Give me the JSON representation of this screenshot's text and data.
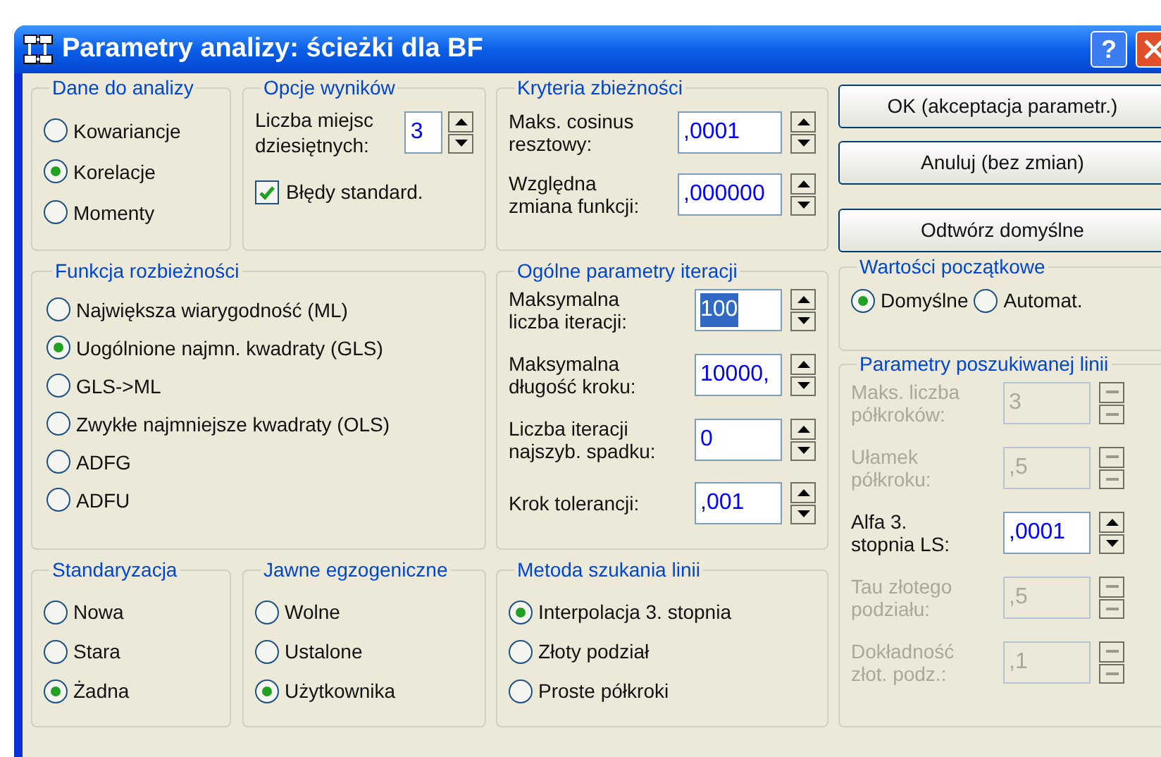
{
  "window": {
    "title": "Parametry analizy: ścieżki dla BF",
    "help_button": "?"
  },
  "data_source": {
    "title": "Dane do analizy",
    "options": [
      {
        "label": "Kowariancje",
        "selected": false
      },
      {
        "label": "Korelacje",
        "selected": true
      },
      {
        "label": "Momenty",
        "selected": false
      }
    ]
  },
  "output_options": {
    "title": "Opcje wyników",
    "decimals": {
      "label": "Liczba miejsc\ndziesiętnych:",
      "value": "3"
    },
    "std_errors": {
      "label": "Błędy standard.",
      "checked": true
    }
  },
  "convergence": {
    "title": "Kryteria zbieżności",
    "fields": [
      {
        "label": "Maks. cosinus\nresztowy:",
        "value": ",0001"
      },
      {
        "label": "Względna\nzmiana funkcji:",
        "value": ",000000"
      }
    ]
  },
  "buttons": [
    "OK (akceptacja parametr.)",
    "Anuluj (bez zmian)",
    "Odtwórz domyślne"
  ],
  "divergence_function": {
    "title": "Funkcja rozbieżności",
    "options": [
      {
        "label": "Największa wiarygodność (ML)",
        "selected": false
      },
      {
        "label": "Uogólnione najmn. kwadraty (GLS)",
        "selected": true
      },
      {
        "label": "GLS->ML",
        "selected": false
      },
      {
        "label": "Zwykłe najmniejsze kwadraty (OLS)",
        "selected": false
      },
      {
        "label": "ADFG",
        "selected": false
      },
      {
        "label": "ADFU",
        "selected": false
      }
    ]
  },
  "iteration": {
    "title": "Ogólne parametry iteracji",
    "fields": [
      {
        "label": "Maksymalna\nliczba iteracji:",
        "value": "100",
        "text_selected": true
      },
      {
        "label": "Maksymalna\ndługość kroku:",
        "value": "10000,",
        "text_selected": false
      },
      {
        "label": "Liczba iteracji\nnajszyb. spadku:",
        "value": "0",
        "text_selected": false
      },
      {
        "label": "Krok tolerancji:",
        "value": ",001",
        "text_selected": false
      }
    ]
  },
  "start_values": {
    "title": "Wartości początkowe",
    "options": [
      {
        "label": "Domyślne",
        "selected": true
      },
      {
        "label": "Automat.",
        "selected": false
      }
    ]
  },
  "line_search_params": {
    "title": "Parametry poszukiwanej linii",
    "fields": [
      {
        "label": "Maks. liczba\npółkroków:",
        "value": "3",
        "disabled": true
      },
      {
        "label": "Ułamek\npółkroku:",
        "value": ",5",
        "disabled": true
      },
      {
        "label": "Alfa 3.\nstopnia LS:",
        "value": ",0001",
        "disabled": false
      },
      {
        "label": "Tau złotego\npodziału:",
        "value": ",5",
        "disabled": true
      },
      {
        "label": "Dokładność\nzłot. podz.:",
        "value": ",1",
        "disabled": true
      }
    ]
  },
  "standardization": {
    "title": "Standaryzacja",
    "options": [
      {
        "label": "Nowa",
        "selected": false
      },
      {
        "label": "Stara",
        "selected": false
      },
      {
        "label": "Żadna",
        "selected": true
      }
    ]
  },
  "exogenous": {
    "title": "Jawne egzogeniczne",
    "options": [
      {
        "label": "Wolne",
        "selected": false
      },
      {
        "label": "Ustalone",
        "selected": false
      },
      {
        "label": "Użytkownika",
        "selected": true
      }
    ]
  },
  "line_search_method": {
    "title": "Metoda szukania linii",
    "options": [
      {
        "label": "Interpolacja 3. stopnia",
        "selected": true
      },
      {
        "label": "Złoty podział",
        "selected": false
      },
      {
        "label": "Proste półkroki",
        "selected": false
      }
    ]
  }
}
